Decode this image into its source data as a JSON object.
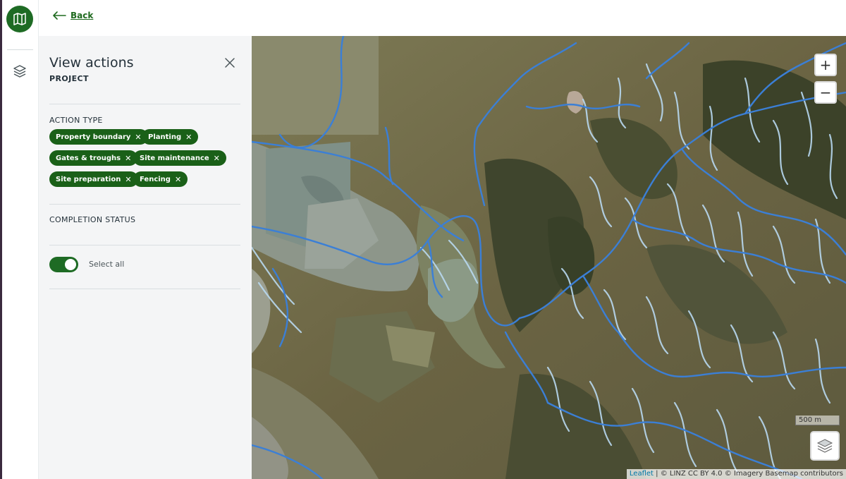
{
  "topbar": {
    "back_label": "Back"
  },
  "rail": {
    "logo_icon": "map-icon",
    "layers_icon": "layers-icon"
  },
  "panel": {
    "title": "View actions",
    "subtitle": "PROJECT",
    "close_icon": "close-icon",
    "action_type_label": "ACTION TYPE",
    "chips": [
      {
        "label": "Property boundary"
      },
      {
        "label": "Planting"
      },
      {
        "label": "Gates & troughs"
      },
      {
        "label": "Site maintenance"
      },
      {
        "label": "Site preparation"
      },
      {
        "label": "Fencing"
      }
    ],
    "completion_label": "COMPLETION STATUS",
    "toggle": {
      "label": "Select all",
      "checked": true
    }
  },
  "map": {
    "zoom_in": "+",
    "zoom_out": "−",
    "scale_label": "500 m",
    "attribution": {
      "leaflet": "Leaflet",
      "linz": "© LINZ CC BY 4.0",
      "imagery": "© Imagery Basemap contributors"
    }
  },
  "colors": {
    "brand_green": "#1e6b24",
    "chip_green": "#1a6018",
    "river_blue": "#3b7fd6",
    "stream_light": "#b8d8f0"
  }
}
